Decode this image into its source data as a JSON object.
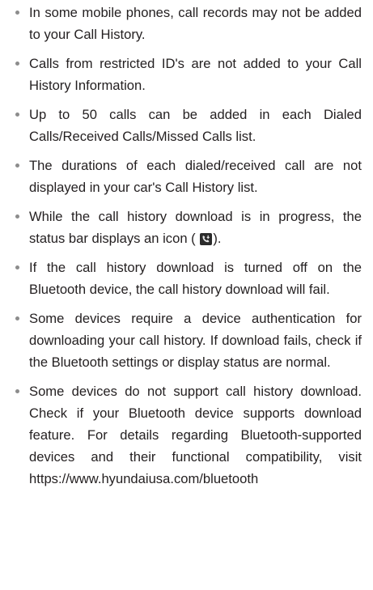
{
  "notes": [
    {
      "text": "In some mobile phones, call records may not be added to your Call History."
    },
    {
      "text": "Calls from restricted ID's are not added to your Call History Information."
    },
    {
      "text": "Up to 50 calls can be added in each Dialed Calls/Received Calls/Missed Calls list."
    },
    {
      "text": "The durations of each dialed/received call are not displayed in your car's Call History list."
    },
    {
      "text_before": "While the call history download is in progress, the status bar displays an icon (",
      "icon": "call-history-download-icon",
      "text_after": ")."
    },
    {
      "text": "If the call history download is turned off on the Bluetooth device, the call history download will fail."
    },
    {
      "text": "Some devices require a device authentication for downloading your call history. If download fails, check if the Bluetooth settings or display status are normal."
    },
    {
      "text": "Some devices do not support call history download. Check if your Bluetooth device supports download feature. For details regarding Bluetooth-supported devices and their functional compatibility, visit https://www.hyundaiusa.com/bluetooth"
    }
  ]
}
